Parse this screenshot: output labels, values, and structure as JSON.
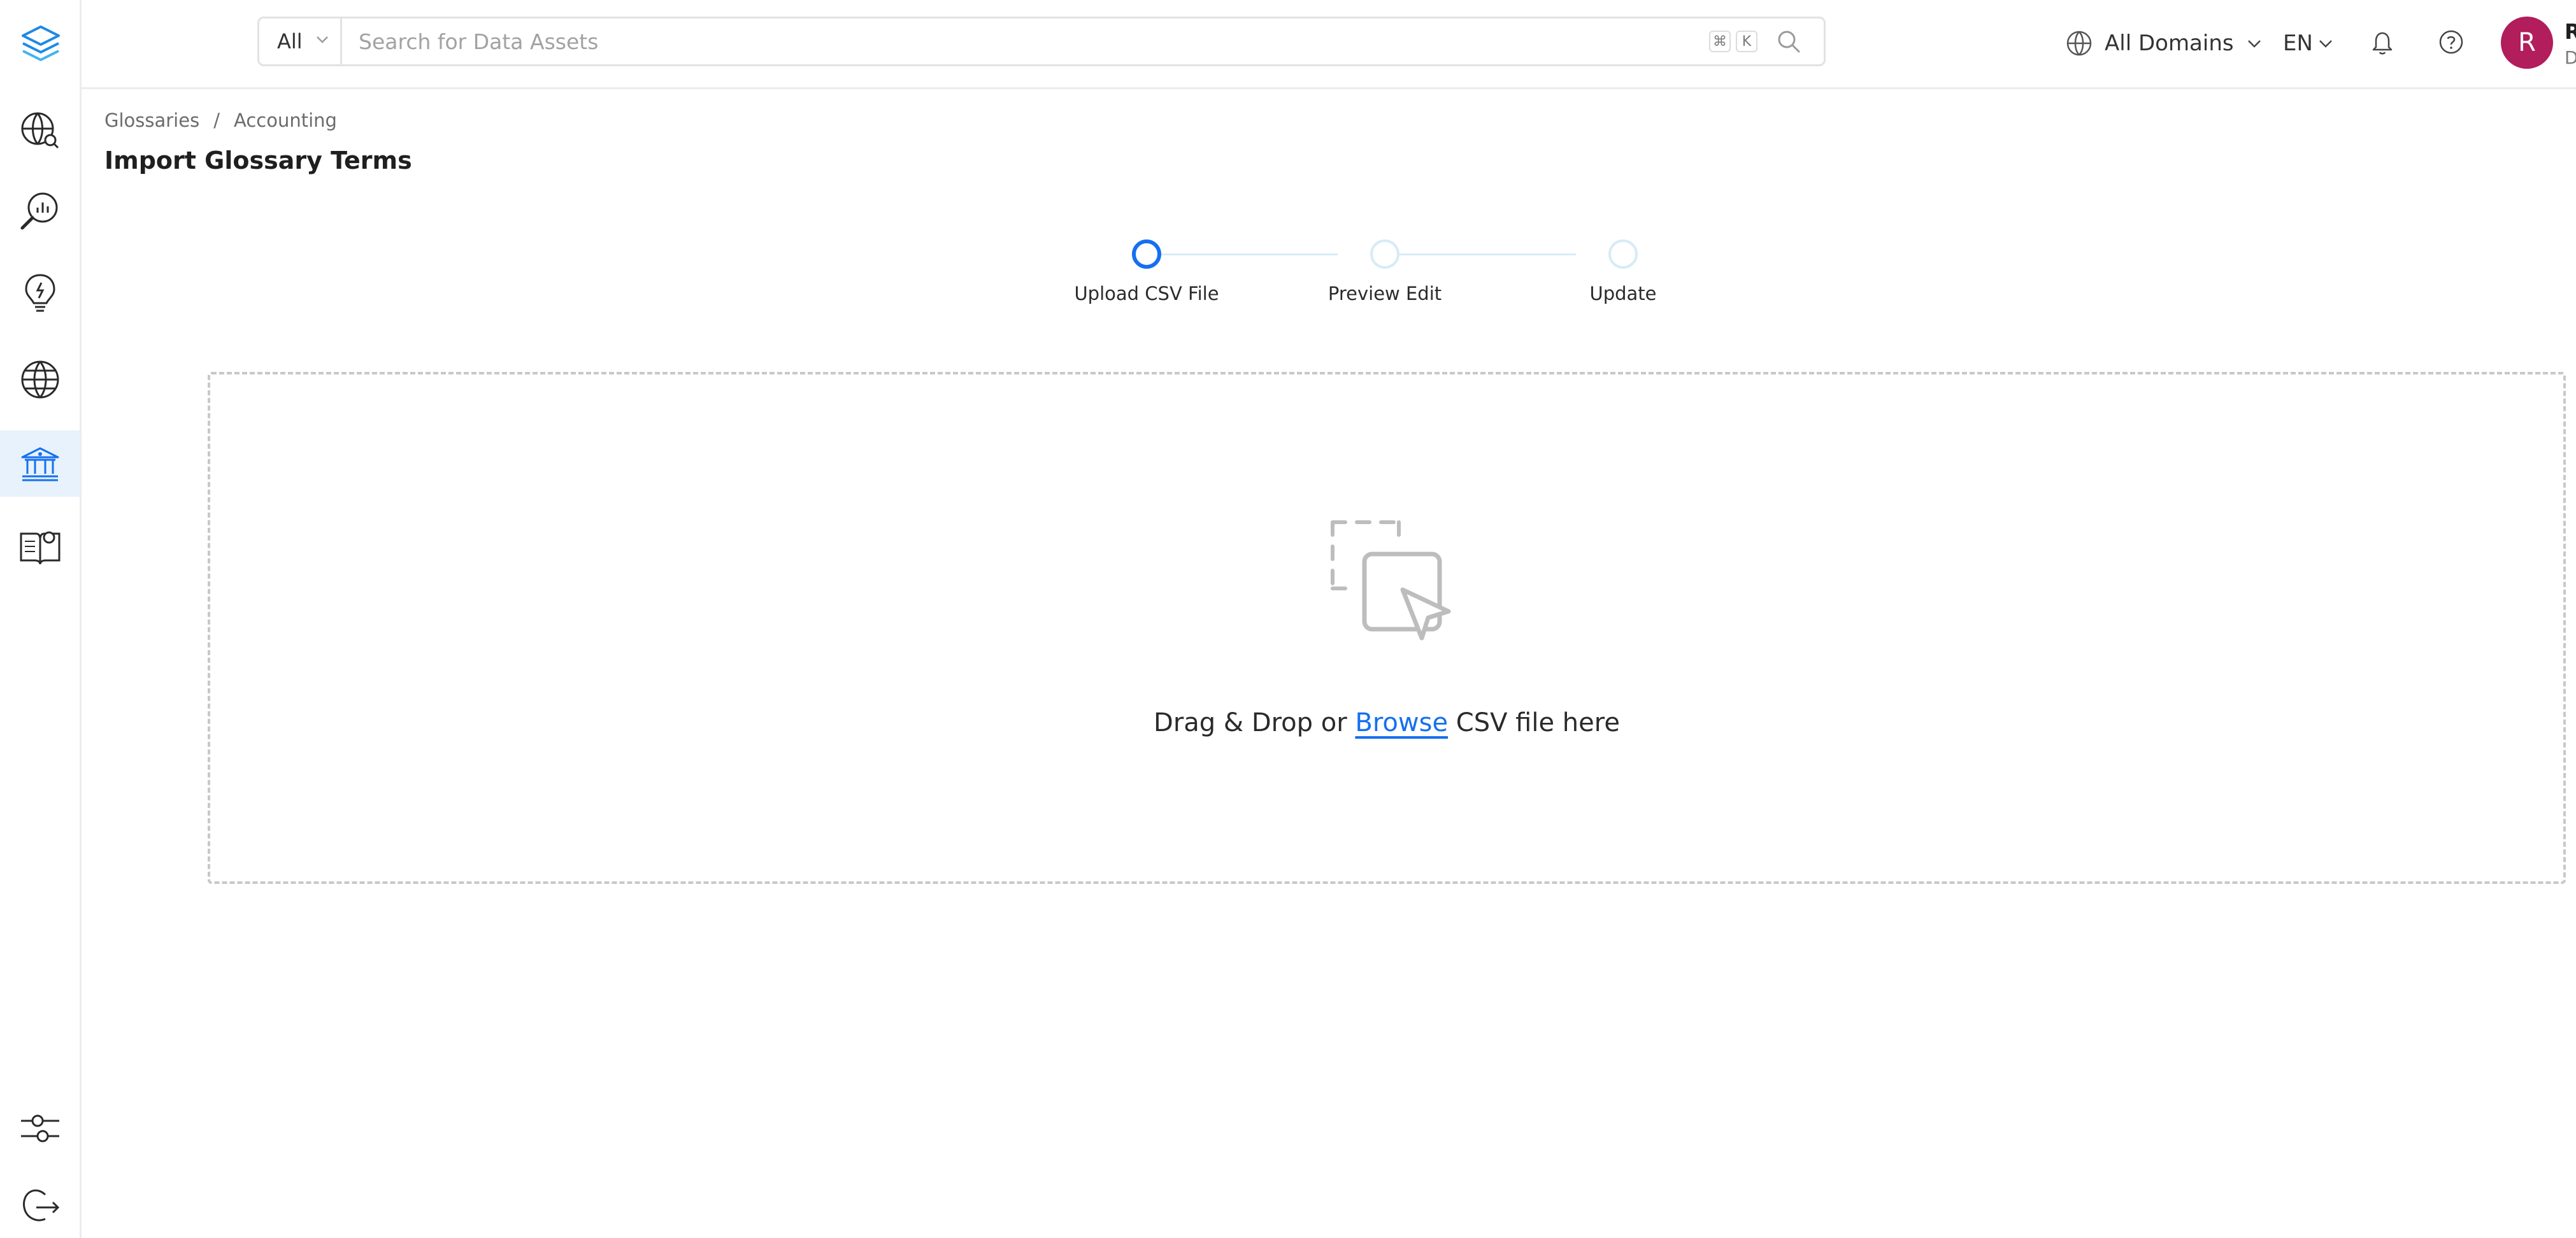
{
  "header": {
    "search": {
      "scope": "All",
      "placeholder": "Search for Data Assets",
      "shortcut_keys": [
        "⌘",
        "K"
      ]
    },
    "domain_selector": "All Domains",
    "language": "EN",
    "user": {
      "initial": "R",
      "name": "Rounakpreet",
      "role": "Data Steward",
      "avatar_color": "#b21d5c"
    }
  },
  "sidebar": {
    "items": [
      {
        "icon": "explore-icon"
      },
      {
        "icon": "data-quality-icon"
      },
      {
        "icon": "insights-icon"
      },
      {
        "icon": "domains-icon"
      },
      {
        "icon": "governance-icon",
        "active": true
      },
      {
        "icon": "knowledge-icon"
      }
    ],
    "bottom_items": [
      {
        "icon": "settings-sliders-icon"
      },
      {
        "icon": "logout-icon"
      }
    ]
  },
  "breadcrumb": {
    "items": [
      "Glossaries",
      "Accounting"
    ],
    "separator": "/"
  },
  "page": {
    "title": "Import Glossary Terms"
  },
  "stepper": {
    "steps": [
      {
        "label": "Upload CSV File",
        "state": "active"
      },
      {
        "label": "Preview Edit",
        "state": "pending"
      },
      {
        "label": "Update",
        "state": "pending"
      }
    ]
  },
  "dropzone": {
    "prefix": "Drag & Drop or ",
    "link": "Browse",
    "suffix": " CSV file here"
  },
  "colors": {
    "accent": "#1470ef",
    "active_nav_bg": "#e8f2fc"
  }
}
